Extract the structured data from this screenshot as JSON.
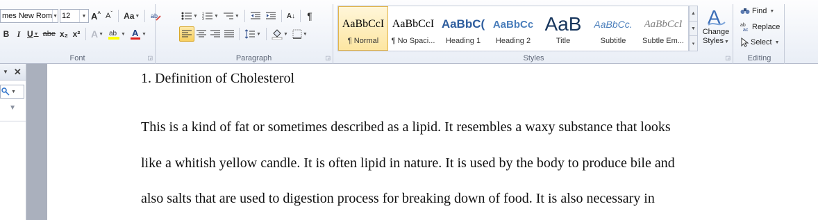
{
  "font_group": {
    "label": "Font",
    "font_name": "mes New Rom",
    "font_size": "12",
    "grow_label": "A",
    "shrink_label": "A",
    "change_case_label": "Aa",
    "bold": "B",
    "italic": "I",
    "underline": "U",
    "strikethrough": "abe",
    "subscript": "x₂",
    "superscript": "x²",
    "text_effects": "A",
    "font_color": "A"
  },
  "paragraph_group": {
    "label": "Paragraph",
    "sort": "A↓",
    "pilcrow": "¶"
  },
  "styles_group": {
    "label": "Styles",
    "tiles": [
      {
        "sample": "AaBbCcI",
        "name": "¶ Normal"
      },
      {
        "sample": "AaBbCcI",
        "name": "¶ No Spaci..."
      },
      {
        "sample": "AaBbC(",
        "name": "Heading 1"
      },
      {
        "sample": "AaBbCc",
        "name": "Heading 2"
      },
      {
        "sample": "AaB",
        "name": "Title"
      },
      {
        "sample": "AaBbCc.",
        "name": "Subtitle"
      },
      {
        "sample": "AaBbCcI",
        "name": "Subtle Em..."
      }
    ],
    "change_styles_line1": "Change",
    "change_styles_line2": "Styles"
  },
  "editing_group": {
    "label": "Editing",
    "find": "Find",
    "replace": "Replace",
    "select": "Select"
  },
  "document": {
    "heading": "1. Definition  of Cholesterol",
    "lines": [
      "This is a kind of fat or sometimes described as a lipid. It resembles a waxy substance that looks",
      "like a whitish yellow candle. It is often lipid in nature. It is used by the body to produce bile and",
      "also salts that are used to digestion process for breaking down of food. It is also necessary in"
    ]
  },
  "colors": {
    "highlight": "#ffff00",
    "font_color": "#e0201b",
    "heading_blue": "#2f5e9e"
  }
}
